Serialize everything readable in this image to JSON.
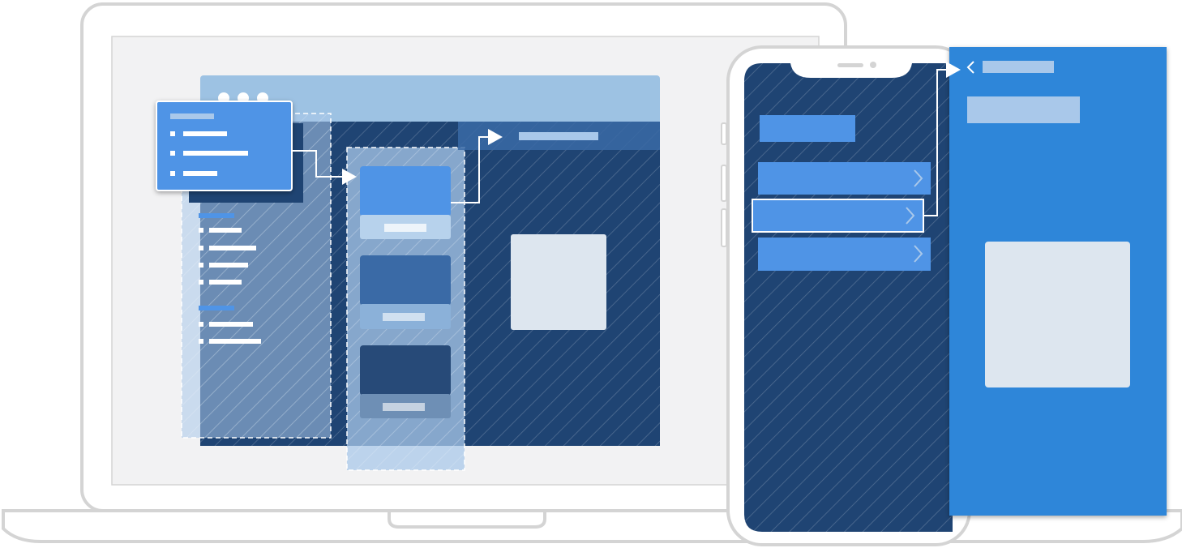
{
  "illustration": {
    "laptop": {
      "app_window": {
        "title_dots": 3,
        "popover_menu": {
          "item_count": 3
        },
        "sidebar_groups": [
          {
            "item_count": 4
          },
          {
            "item_count": 2
          }
        ],
        "cards": [
          {
            "tone": "light"
          },
          {
            "tone": "medium"
          },
          {
            "tone": "dark"
          }
        ],
        "detail_pane": {
          "has_header": true,
          "has_content_box": true
        }
      }
    },
    "phone": {
      "list_rows": 3,
      "selected_row": 2,
      "detail_screen": {
        "has_back_chevron": true,
        "has_title": true,
        "has_content_box": true
      }
    },
    "colors": {
      "outline": "#d4d4d4",
      "screen_bg": "#f2f2f3",
      "window_titlebar": "#9dc2e3",
      "navy": "#1f4473",
      "accent_blue": "#4f94e6",
      "bright_blue": "#2e86d9",
      "light_box": "#dde6ef"
    }
  }
}
